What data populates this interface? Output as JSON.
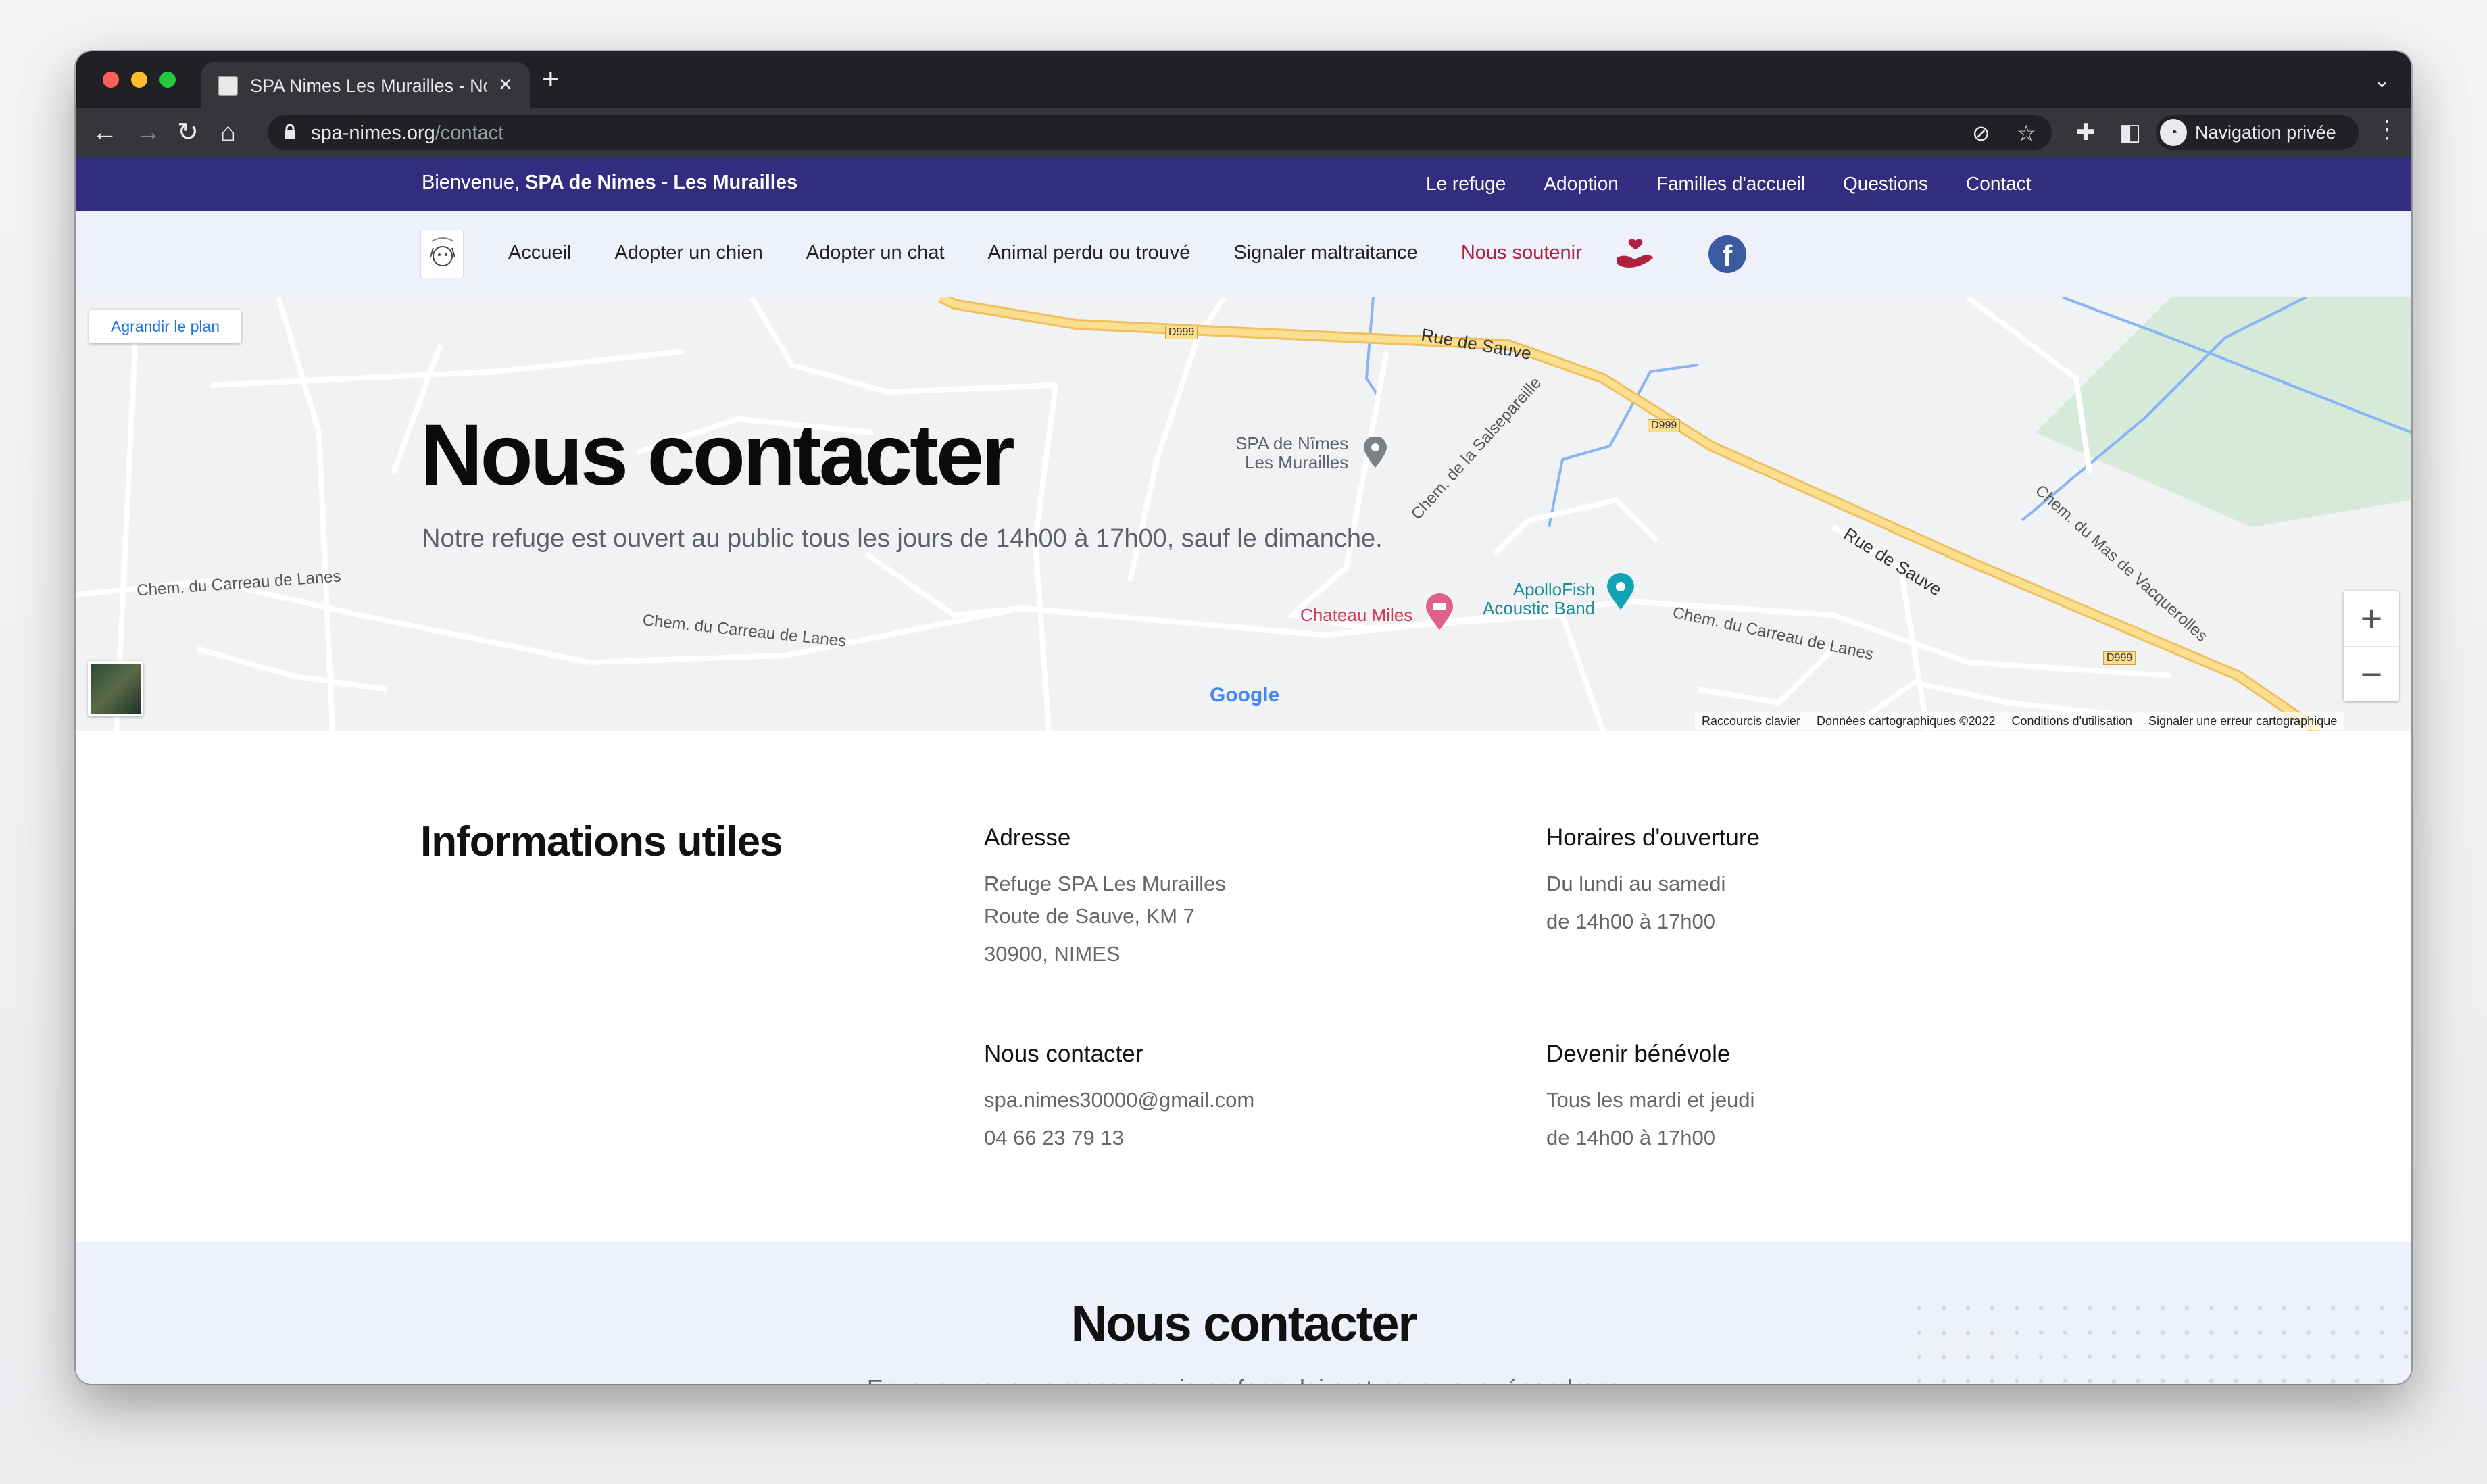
{
  "browser": {
    "tab_title": "SPA Nimes Les Murailles - Nous contacter",
    "url_host": "spa-nimes.org",
    "url_path": "/contact",
    "profile_label": "Navigation privée"
  },
  "site": {
    "welcome_prefix": "Bienvenue, ",
    "welcome_name": "SPA de Nimes - Les Murailles",
    "top_links": [
      "Le refuge",
      "Adoption",
      "Familles d'accueil",
      "Questions",
      "Contact"
    ],
    "nav": [
      "Accueil",
      "Adopter un chien",
      "Adopter un chat",
      "Animal perdu ou trouvé",
      "Signaler maltraitance",
      "Nous soutenir"
    ],
    "colors": {
      "top_bar": "#332d80",
      "nav_bg": "#eef0fb",
      "accent": "#b0213e",
      "facebook": "#3b5aa0"
    }
  },
  "map": {
    "enlarge_label": "Agrandir le plan",
    "roads": [
      "Rue de Sauve",
      "Rue de Sauve",
      "Chem. du Carreau de Lanes",
      "Chem. du Carreau de Lanes",
      "Chem. du Carreau de Lanes",
      "Chem. de la Salsepareille",
      "Chem. du Mas de Vacquerolles"
    ],
    "route_codes": [
      "D999",
      "D999",
      "D999"
    ],
    "pois": [
      "SPA de Nîmes",
      "Les Murailles",
      "Chateau Miles",
      "ApolloFish",
      "Acoustic Band"
    ],
    "google_label": "Google",
    "attribution": [
      "Raccourcis clavier",
      "Données cartographiques ©2022",
      "Conditions d'utilisation",
      "Signaler une erreur cartographique"
    ]
  },
  "hero": {
    "title": "Nous contacter",
    "subtitle": "Notre refuge est ouvert au public tous les jours de 14h00 à 17h00, sauf le dimanche."
  },
  "info": {
    "heading": "Informations utiles",
    "address": {
      "title": "Adresse",
      "lines": [
        "Refuge SPA Les Murailles",
        "Route de Sauve, KM 7",
        "30900, NIMES"
      ]
    },
    "hours": {
      "title": "Horaires d'ouverture",
      "lines": [
        "Du lundi au samedi",
        "de 14h00 à 17h00"
      ]
    },
    "contact": {
      "title": "Nous contacter",
      "lines": [
        "spa.nimes30000@gmail.com",
        "04 66 23 79 13"
      ]
    },
    "volunteer": {
      "title": "Devenir bénévole",
      "lines": [
        "Tous les mardi et jeudi",
        "de 14h00 à 17h00"
      ]
    }
  },
  "contact_form": {
    "title": "Nous contacter",
    "subtitle": "Envoyez-nous un message via ce formulaire et nous vous répondrons"
  }
}
